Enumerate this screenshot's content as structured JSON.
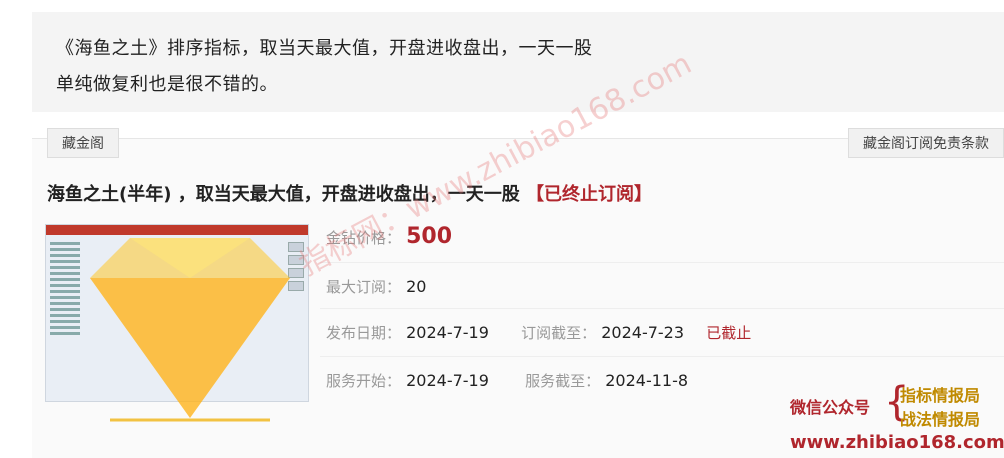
{
  "quote": {
    "line1": "《海鱼之土》排序指标，取当天最大值，开盘进收盘出，一天一股",
    "line2": "单纯做复利也是很不错的。"
  },
  "panel": {
    "left_tag": "藏金阁",
    "right_tag": "藏金阁订阅免责条款",
    "title_main": "海鱼之土(半年) ，取当天最大值，开盘进收盘出，一天一股",
    "title_status": "【已终止订阅】"
  },
  "details": {
    "price_label": "金钻价格：",
    "price_value": "500",
    "max_sub_label": "最大订阅：",
    "max_sub_value": "20",
    "publish_label": "发布日期：",
    "publish_value": "2024-7-19",
    "sub_end_label": "订阅截至：",
    "sub_end_value": "2024-7-23",
    "sub_end_status": "已截止",
    "service_start_label": "服务开始：",
    "service_start_value": "2024-7-19",
    "service_end_label": "服务截至：",
    "service_end_value": "2024-11-8"
  },
  "watermark": "指标网：www.zhibiao168.com",
  "promo": {
    "wechat": "微信公众号",
    "item1": "指标情报局",
    "item2": "战法情报局",
    "site": "www.zhibiao168.com"
  },
  "colors": {
    "accent_red": "#b0262d",
    "gold": "#c08a00"
  }
}
